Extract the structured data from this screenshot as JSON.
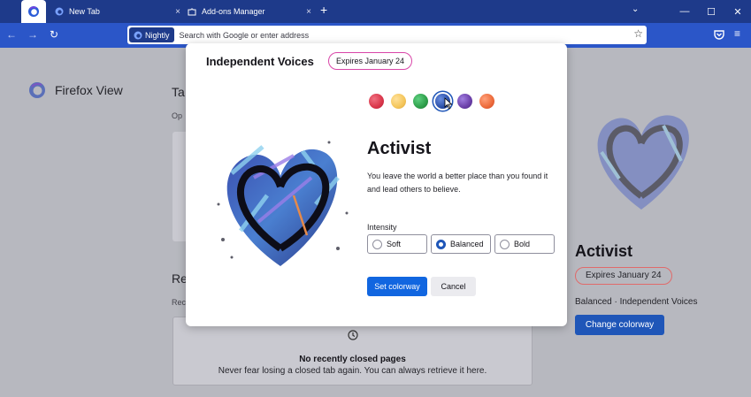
{
  "tabs": {
    "items": [
      {
        "label": "New Tab",
        "close": "×"
      },
      {
        "label": "Add-ons Manager",
        "close": "×"
      }
    ],
    "new_tab": "+",
    "list_all": "⌄"
  },
  "window_controls": {
    "minimize": "—",
    "maximize": "☐",
    "close": "✕"
  },
  "navbar": {
    "back": "←",
    "forward": "→",
    "reload": "↻",
    "identity_label": "Nightly",
    "url_placeholder": "Search with Google or enter address",
    "bookmark": "☆",
    "menu": "≡"
  },
  "page": {
    "firefox_view_title": "Firefox View",
    "heading1": "Ta",
    "sub1": "Op",
    "heading2": "Re",
    "sub2": "Rec",
    "closed_title": "No recently closed pages",
    "closed_desc": "Never fear losing a closed tab again. You can always retrieve it here.",
    "colorway_name": "Activist",
    "expires": "Expires January 24",
    "meta": "Balanced · Independent Voices",
    "change_button": "Change colorway"
  },
  "modal": {
    "title": "Independent Voices",
    "expires": "Expires January 24",
    "swatches": [
      {
        "color": "#d9364a",
        "label": "red"
      },
      {
        "color": "#f4c55a",
        "label": "yellow"
      },
      {
        "color": "#2e9e4a",
        "label": "green"
      },
      {
        "color": "#2a4fa8",
        "label": "blue",
        "selected": true
      },
      {
        "color": "#6b3fa8",
        "label": "purple"
      },
      {
        "color": "#ec6a3a",
        "label": "orange"
      }
    ],
    "colorway_name": "Activist",
    "description": "You leave the world a better place than you found it and lead others to believe.",
    "intensity_label": "Intensity",
    "intensity_options": [
      {
        "label": "Soft",
        "checked": false
      },
      {
        "label": "Balanced",
        "checked": true
      },
      {
        "label": "Bold",
        "checked": false
      }
    ],
    "set_button": "Set colorway",
    "cancel_button": "Cancel"
  },
  "colors": {
    "tabbar": "#1e3a8a",
    "navbar": "#2b56c8",
    "accent": "#1166e0"
  }
}
